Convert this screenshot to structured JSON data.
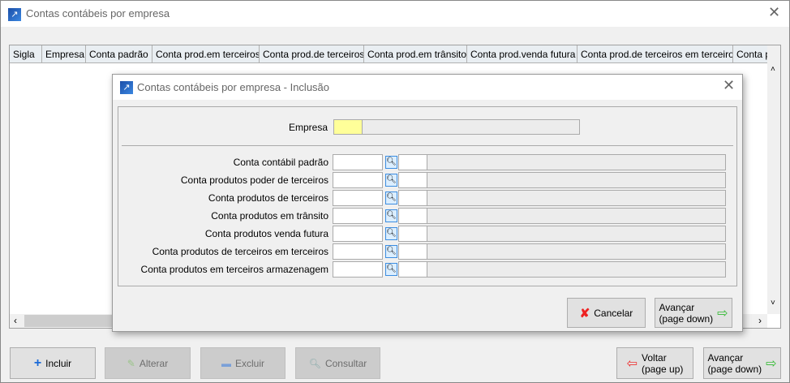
{
  "window": {
    "title": "Contas contábeis por empresa",
    "close": "✕"
  },
  "grid": {
    "columns": [
      "Sigla",
      "Empresa",
      "Conta padrão",
      "Conta prod.em terceiros",
      "Conta prod.de terceiros",
      "Conta prod.em trânsito",
      "Conta prod.venda futura",
      "Conta prod.de terceiros em terceiros",
      "Conta p"
    ]
  },
  "toolbar": {
    "incluir": "Incluir",
    "alterar": "Alterar",
    "excluir": "Excluir",
    "consultar": "Consultar",
    "voltar": "Voltar",
    "voltar_sub": "(page up)",
    "avancar": "Avançar",
    "avancar_sub": "(page down)"
  },
  "dialog": {
    "title": "Contas contábeis por empresa - Inclusão",
    "close": "✕",
    "empresa_label": "Empresa",
    "rows": [
      {
        "label": "Conta contábil padrão"
      },
      {
        "label": "Conta produtos poder de terceiros"
      },
      {
        "label": "Conta produtos de terceiros"
      },
      {
        "label": "Conta produtos em trânsito"
      },
      {
        "label": "Conta produtos venda futura"
      },
      {
        "label": "Conta produtos de terceiros em terceiros"
      },
      {
        "label": "Conta produtos em terceiros armazenagem"
      }
    ],
    "cancelar": "Cancelar",
    "avancar": "Avançar",
    "avancar_sub": "(page down)"
  }
}
